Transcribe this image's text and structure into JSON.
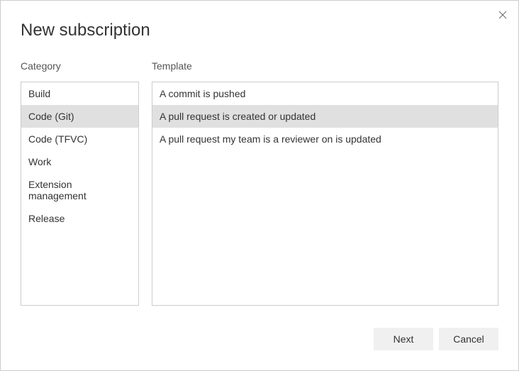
{
  "dialog": {
    "title": "New subscription"
  },
  "category": {
    "label": "Category",
    "items": [
      {
        "label": "Build",
        "selected": false
      },
      {
        "label": "Code (Git)",
        "selected": true
      },
      {
        "label": "Code (TFVC)",
        "selected": false
      },
      {
        "label": "Work",
        "selected": false
      },
      {
        "label": "Extension management",
        "selected": false
      },
      {
        "label": "Release",
        "selected": false
      }
    ]
  },
  "template": {
    "label": "Template",
    "items": [
      {
        "label": "A commit is pushed",
        "selected": false
      },
      {
        "label": "A pull request is created or updated",
        "selected": true
      },
      {
        "label": "A pull request my team is a reviewer on is updated",
        "selected": false
      }
    ]
  },
  "footer": {
    "next_label": "Next",
    "cancel_label": "Cancel"
  }
}
